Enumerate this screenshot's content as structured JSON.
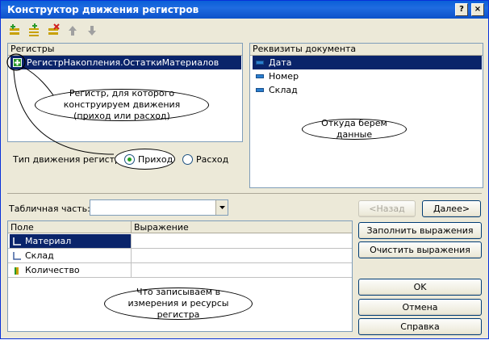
{
  "window": {
    "title": "Конструктор движения регистров",
    "help_button": "?",
    "close_button": "×"
  },
  "toolbar": {
    "icons": [
      "add-register-icon",
      "add-all-registers-icon",
      "delete-register-icon",
      "move-up-icon",
      "move-down-icon"
    ]
  },
  "registers_panel": {
    "header": "Регистры",
    "items": [
      {
        "label": "РегистрНакопления.ОстаткиМатериалов",
        "selected": true
      }
    ]
  },
  "movement_type": {
    "label": "Тип движения регистра:",
    "options": [
      {
        "label": "Приход",
        "selected": true
      },
      {
        "label": "Расход",
        "selected": false
      }
    ]
  },
  "attributes_panel": {
    "header": "Реквизиты документа",
    "items": [
      {
        "label": "Дата",
        "selected": true
      },
      {
        "label": "Номер",
        "selected": false
      },
      {
        "label": "Склад",
        "selected": false
      }
    ]
  },
  "tabular_part": {
    "label": "Табличная часть:",
    "value": ""
  },
  "nav": {
    "back": "<Назад",
    "next": "Далее>"
  },
  "fields_table": {
    "columns": [
      "Поле",
      "Выражение"
    ],
    "rows": [
      {
        "field": "Материал",
        "expression": "",
        "selected": true,
        "icon": "dimension-icon"
      },
      {
        "field": "Склад",
        "expression": "",
        "selected": false,
        "icon": "dimension-icon"
      },
      {
        "field": "Количество",
        "expression": "",
        "selected": false,
        "icon": "resource-icon"
      }
    ]
  },
  "side_buttons": {
    "fill": "Заполнить выражения",
    "clear": "Очистить выражения",
    "ok": "OK",
    "cancel": "Отмена",
    "help": "Справка"
  },
  "annotations": {
    "register": "Регистр, для которого конструируем движения  (приход или расход)",
    "source": "Откуда берем данные",
    "target": "Что записываем в измерения и ресурсы регистра"
  },
  "colors": {
    "selection": "#0a246a",
    "titlebar": "#0a5fd8",
    "window_bg": "#ece9d8"
  }
}
